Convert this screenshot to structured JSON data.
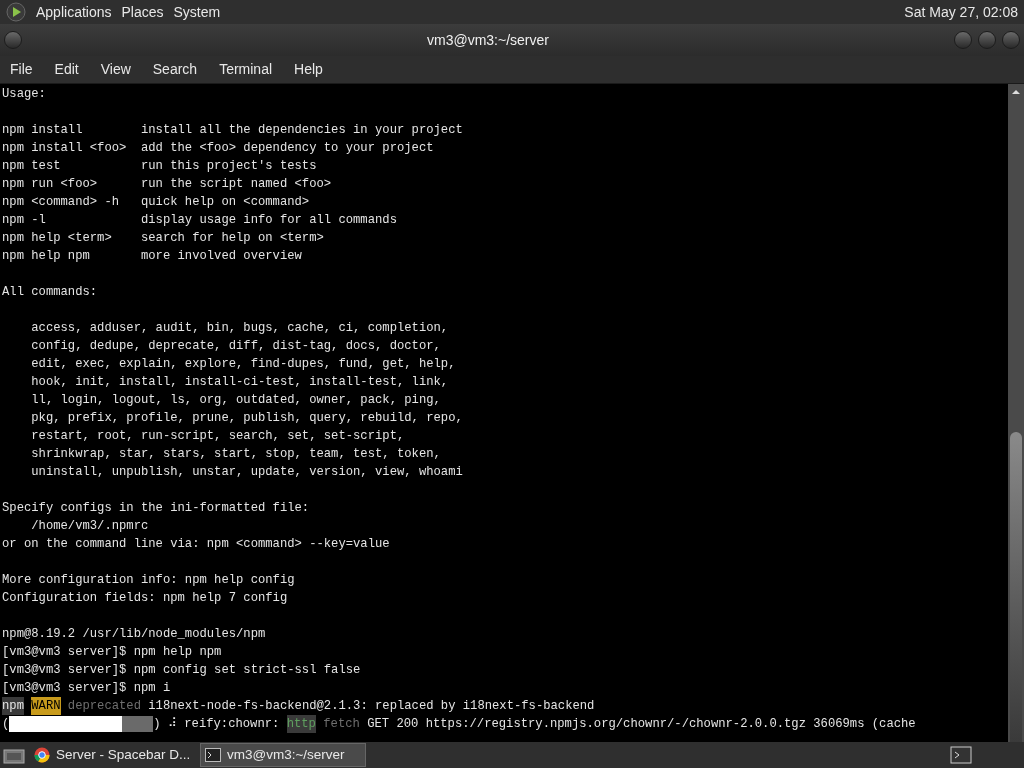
{
  "top_panel": {
    "menus": [
      "Applications",
      "Places",
      "System"
    ],
    "clock": "Sat May 27, 02:08"
  },
  "window": {
    "title": "vm3@vm3:~/server"
  },
  "menu_bar": [
    "File",
    "Edit",
    "View",
    "Search",
    "Terminal",
    "Help"
  ],
  "terminal": {
    "lines": [
      {
        "kind": "text",
        "text": "Usage:"
      },
      {
        "kind": "blank"
      },
      {
        "kind": "text",
        "text": "npm install        install all the dependencies in your project"
      },
      {
        "kind": "text",
        "text": "npm install <foo>  add the <foo> dependency to your project"
      },
      {
        "kind": "text",
        "text": "npm test           run this project's tests"
      },
      {
        "kind": "text",
        "text": "npm run <foo>      run the script named <foo>"
      },
      {
        "kind": "text",
        "text": "npm <command> -h   quick help on <command>"
      },
      {
        "kind": "text",
        "text": "npm -l             display usage info for all commands"
      },
      {
        "kind": "text",
        "text": "npm help <term>    search for help on <term>"
      },
      {
        "kind": "text",
        "text": "npm help npm       more involved overview"
      },
      {
        "kind": "blank"
      },
      {
        "kind": "text",
        "text": "All commands:"
      },
      {
        "kind": "blank"
      },
      {
        "kind": "text",
        "text": "    access, adduser, audit, bin, bugs, cache, ci, completion,"
      },
      {
        "kind": "text",
        "text": "    config, dedupe, deprecate, diff, dist-tag, docs, doctor,"
      },
      {
        "kind": "text",
        "text": "    edit, exec, explain, explore, find-dupes, fund, get, help,"
      },
      {
        "kind": "text",
        "text": "    hook, init, install, install-ci-test, install-test, link,"
      },
      {
        "kind": "text",
        "text": "    ll, login, logout, ls, org, outdated, owner, pack, ping,"
      },
      {
        "kind": "text",
        "text": "    pkg, prefix, profile, prune, publish, query, rebuild, repo,"
      },
      {
        "kind": "text",
        "text": "    restart, root, run-script, search, set, set-script,"
      },
      {
        "kind": "text",
        "text": "    shrinkwrap, star, stars, start, stop, team, test, token,"
      },
      {
        "kind": "text",
        "text": "    uninstall, unpublish, unstar, update, version, view, whoami"
      },
      {
        "kind": "blank"
      },
      {
        "kind": "text",
        "text": "Specify configs in the ini-formatted file:"
      },
      {
        "kind": "text",
        "text": "    /home/vm3/.npmrc"
      },
      {
        "kind": "text",
        "text": "or on the command line via: npm <command> --key=value"
      },
      {
        "kind": "blank"
      },
      {
        "kind": "text",
        "text": "More configuration info: npm help config"
      },
      {
        "kind": "text",
        "text": "Configuration fields: npm help 7 config"
      },
      {
        "kind": "blank"
      },
      {
        "kind": "text",
        "text": "npm@8.19.2 /usr/lib/node_modules/npm"
      },
      {
        "kind": "text",
        "text": "[vm3@vm3 server]$ npm help npm"
      },
      {
        "kind": "text",
        "text": "[vm3@vm3 server]$ npm config set strict-ssl false"
      },
      {
        "kind": "text",
        "text": "[vm3@vm3 server]$ npm i"
      },
      {
        "kind": "segments",
        "segments": [
          {
            "kind": "label",
            "text": "npm"
          },
          {
            "kind": "gap"
          },
          {
            "kind": "warn",
            "text": "WARN"
          },
          {
            "kind": "gap"
          },
          {
            "kind": "dim",
            "text": "deprecated"
          },
          {
            "kind": "plain",
            "text": " i18next-node-fs-backend@2.1.3: replaced by i18next-fs-backend"
          }
        ]
      },
      {
        "kind": "segments",
        "segments": [
          {
            "kind": "plain",
            "text": "("
          },
          {
            "kind": "progress",
            "level": 0.78
          },
          {
            "kind": "plain",
            "text": ") ⠼ reify:chownr: "
          },
          {
            "kind": "http",
            "text": "http"
          },
          {
            "kind": "gap"
          },
          {
            "kind": "dim",
            "text": "fetch"
          },
          {
            "kind": "plain",
            "text": " GET 200 https://registry.npmjs.org/chownr/-/chownr-2.0.0.tgz 36069ms (cache"
          }
        ]
      }
    ]
  },
  "taskbar": {
    "items": [
      {
        "label": "Server - Spacebar D...",
        "kind": "browser",
        "selected": false
      },
      {
        "label": "vm3@vm3:~/server",
        "kind": "terminal",
        "selected": true
      }
    ]
  }
}
